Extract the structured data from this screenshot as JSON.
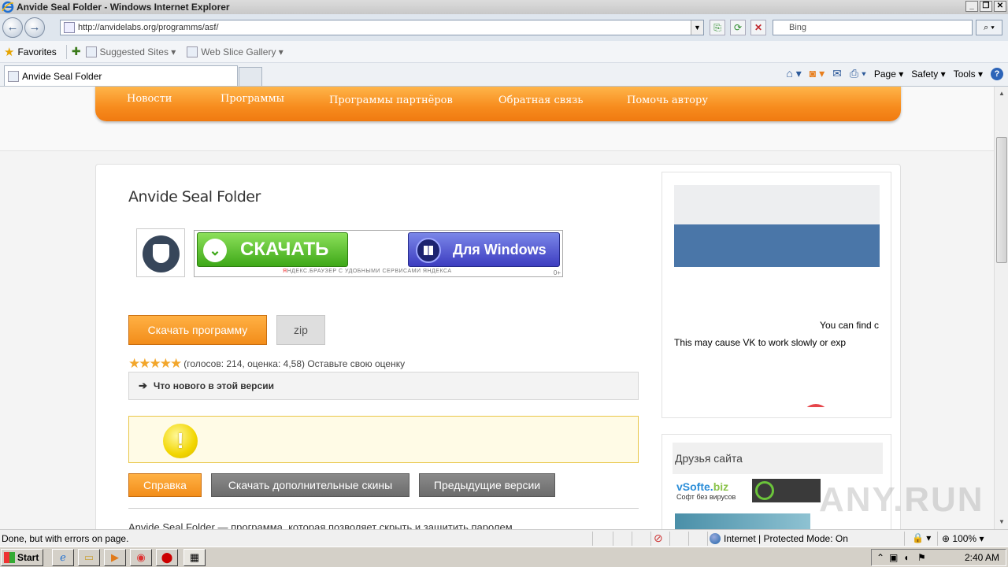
{
  "window": {
    "title": "Anvide Seal Folder - Windows Internet Explorer",
    "minimize": "_",
    "restore": "❐",
    "close": "✕"
  },
  "address": {
    "url": "http://anvidelabs.org/programms/asf/",
    "search_placeholder": "Bing",
    "back_glyph": "←",
    "forward_glyph": "→"
  },
  "favorites": {
    "label": "Favorites",
    "suggested": "Suggested Sites ▾",
    "gallery": "Web Slice Gallery ▾"
  },
  "tab": {
    "title": "Anvide Seal Folder"
  },
  "command_bar": {
    "page": "Page ▾",
    "safety": "Safety ▾",
    "tools": "Tools ▾",
    "help": "?"
  },
  "site_nav": {
    "items": [
      "Новости",
      "Программы",
      "Программы партнёров",
      "Обратная связь",
      "Помочь автору"
    ]
  },
  "main": {
    "title": "Anvide Seal Folder",
    "banner_download": "СКАЧАТЬ",
    "banner_windows": "Для Windows",
    "banner_caption_y": "Я",
    "banner_caption": "НДЕКС.БРАУЗЕР  С УДОБНЫМИ СЕРВИСАМИ ЯНДЕКСА",
    "banner_age": "0+",
    "download_button": "Скачать программу",
    "zip_button": "zip",
    "rating_text": "(голосов: 214, оценка: 4,58) Оставьте свою оценку",
    "stars": "★★★★★",
    "whats_new": "Что нового в этой версии",
    "help_button": "Справка",
    "skins_button": "Скачать дополнительные скины",
    "prev_versions_button": "Предыдущие версии",
    "bottom_text": "Anvide Seal Folder — программа, которая позволяет скрыть и защитить паролем"
  },
  "sidebar": {
    "vk_msg1": "You can find c",
    "vk_msg2": "This may cause VK to work slowly or exp",
    "friends_title": "Друзья сайта",
    "vsofte_logo_a": "vSofte.",
    "vsofte_logo_b": "biz",
    "vsofte_sub": "Софт без вирусов"
  },
  "watermark": "ANY.RUN",
  "status": {
    "text": "Done, but with errors on page.",
    "zone": "Internet | Protected Mode: On",
    "zoom": "100%"
  },
  "taskbar": {
    "start": "Start",
    "clock": "2:40 AM"
  }
}
